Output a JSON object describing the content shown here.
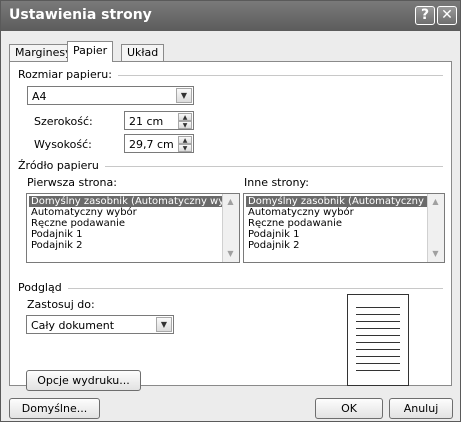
{
  "window": {
    "title": "Ustawienia strony"
  },
  "titlebar_buttons": {
    "help": "?",
    "close": "✕"
  },
  "tabs": [
    {
      "label": "Marginesy",
      "active": false
    },
    {
      "label": "Papier",
      "active": true
    },
    {
      "label": "Układ",
      "active": false
    }
  ],
  "paper_size": {
    "group_label": "Rozmiar papieru:",
    "size_value": "A4",
    "width_label": "Szerokość:",
    "width_value": "21 cm",
    "height_label": "Wysokość:",
    "height_value": "29,7 cm"
  },
  "paper_source": {
    "group_label": "Źródło papieru",
    "first_page_label": "Pierwsza strona:",
    "other_pages_label": "Inne strony:",
    "first_page_items": [
      "Domyślny zasobnik (Automatyczny wybór)",
      "Automatyczny wybór",
      "Ręczne podawanie",
      "Podajnik 1",
      "Podajnik 2"
    ],
    "other_pages_items": [
      "Domyślny zasobnik (Automatyczny wybór)",
      "Automatyczny wybór",
      "Ręczne podawanie",
      "Podajnik 1",
      "Podajnik 2"
    ]
  },
  "preview": {
    "group_label": "Podgląd",
    "apply_to_label": "Zastosuj do:",
    "apply_to_value": "Cały dokument",
    "print_options_button": "Opcje wydruku..."
  },
  "footer": {
    "default_button": "Domyślne...",
    "ok_button": "OK",
    "cancel_button": "Anuluj"
  },
  "icons": {
    "dropdown": "chevron-down-icon",
    "spin_up": "triangle-up-icon",
    "spin_down": "triangle-down-icon"
  }
}
